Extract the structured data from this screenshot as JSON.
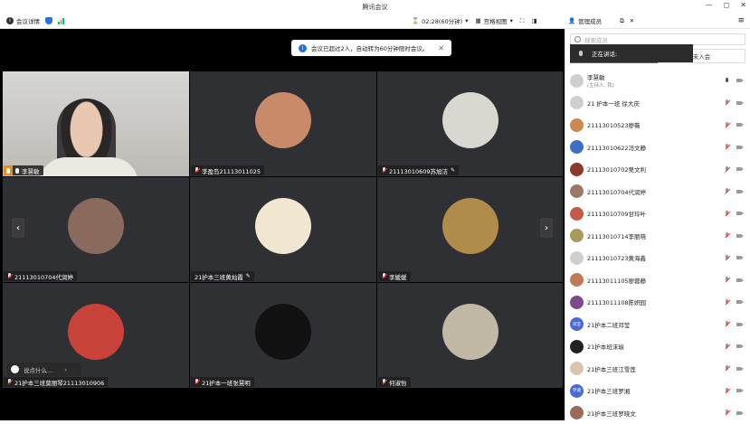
{
  "window": {
    "title": "腾讯会议",
    "controls": [
      "—",
      "◻",
      "✕"
    ]
  },
  "toolbar": {
    "meeting_info": "会议详情",
    "timer": "02:28(60分钟)",
    "layout": "宫格视图",
    "manage_members": "管理成员"
  },
  "notice": {
    "text": "会议已超过2人，自动转为60分钟限时会议。"
  },
  "tiles": [
    {
      "name": "李慧敏",
      "host": true,
      "mic": "on",
      "video": true
    },
    {
      "name": "李盈岛21113011025",
      "mic": "muted",
      "avatar_color": "#c98a6a"
    },
    {
      "name": "21113010609苏旭洁",
      "mic": "muted",
      "editable": true,
      "avatar_color": "#d8d8d0"
    },
    {
      "name": "21113010704代润婷",
      "mic": "muted",
      "avatar_color": "#8a6a5c"
    },
    {
      "name": "21护本三班黄灿霞",
      "mic": "none",
      "editable": true,
      "avatar_color": "#f1e6cf"
    },
    {
      "name": "李媛媛",
      "mic": "muted",
      "avatar_color": "#b08b4a"
    },
    {
      "name": "21护本三班莫丽琴21113010906",
      "mic": "muted",
      "avatar_color": "#c9433a"
    },
    {
      "name": "21护本一班张慧明",
      "mic": "muted",
      "avatar_color": "#111111"
    },
    {
      "name": "何淑怡",
      "mic": "muted",
      "avatar_color": "#c2b8a6"
    }
  ],
  "chat": {
    "placeholder": "说点什么..."
  },
  "panel": {
    "search_placeholder": "搜索成员",
    "tabs": [
      "会中",
      "未入会"
    ],
    "speaking": "正在讲话:",
    "members": [
      {
        "name": "李慧敏",
        "sub": "(主持人, 我)",
        "mic": "on",
        "avatar_color": "#cfcfcf"
      },
      {
        "name": "21 护本一班 徐大庆",
        "mic": "muted",
        "avatar_color": "#cfcfcf"
      },
      {
        "name": "21113010523廖薇",
        "mic": "muted",
        "avatar_color": "#c9894f"
      },
      {
        "name": "21113010622冯文静",
        "mic": "muted",
        "avatar_color": "#3d6fc7"
      },
      {
        "name": "21113010702吴文利",
        "mic": "muted",
        "avatar_color": "#8a3a2a"
      },
      {
        "name": "21113010704代润婷",
        "mic": "muted",
        "avatar_color": "#9a7a66"
      },
      {
        "name": "21113010709甘玲叶",
        "mic": "muted",
        "avatar_color": "#c55a4a"
      },
      {
        "name": "21113010714李丽晓",
        "mic": "muted",
        "avatar_color": "#a89a5a"
      },
      {
        "name": "21113010723黄海鑫",
        "mic": "muted",
        "avatar_color": "#cfcfcf"
      },
      {
        "name": "21113011105廖蓉静",
        "mic": "muted",
        "avatar_color": "#c07a5a"
      },
      {
        "name": "21113011108陈妍园",
        "mic": "muted",
        "avatar_color": "#7a4a8a"
      },
      {
        "name": "21护本二班邓莹",
        "mic": "muted",
        "avatar_color": "#4a6ad8",
        "avatar_text": "邓莹"
      },
      {
        "name": "21护本班沫瑜",
        "mic": "muted",
        "avatar_color": "#222222"
      },
      {
        "name": "21护本三班江雪莲",
        "mic": "muted",
        "avatar_color": "#d8c7b0"
      },
      {
        "name": "21护本三班罗湘",
        "mic": "muted",
        "avatar_color": "#4a6ad8",
        "avatar_text": "罗湘"
      },
      {
        "name": "21护本三班罗晓文",
        "mic": "muted",
        "avatar_color": "#9a6a5a"
      }
    ]
  }
}
